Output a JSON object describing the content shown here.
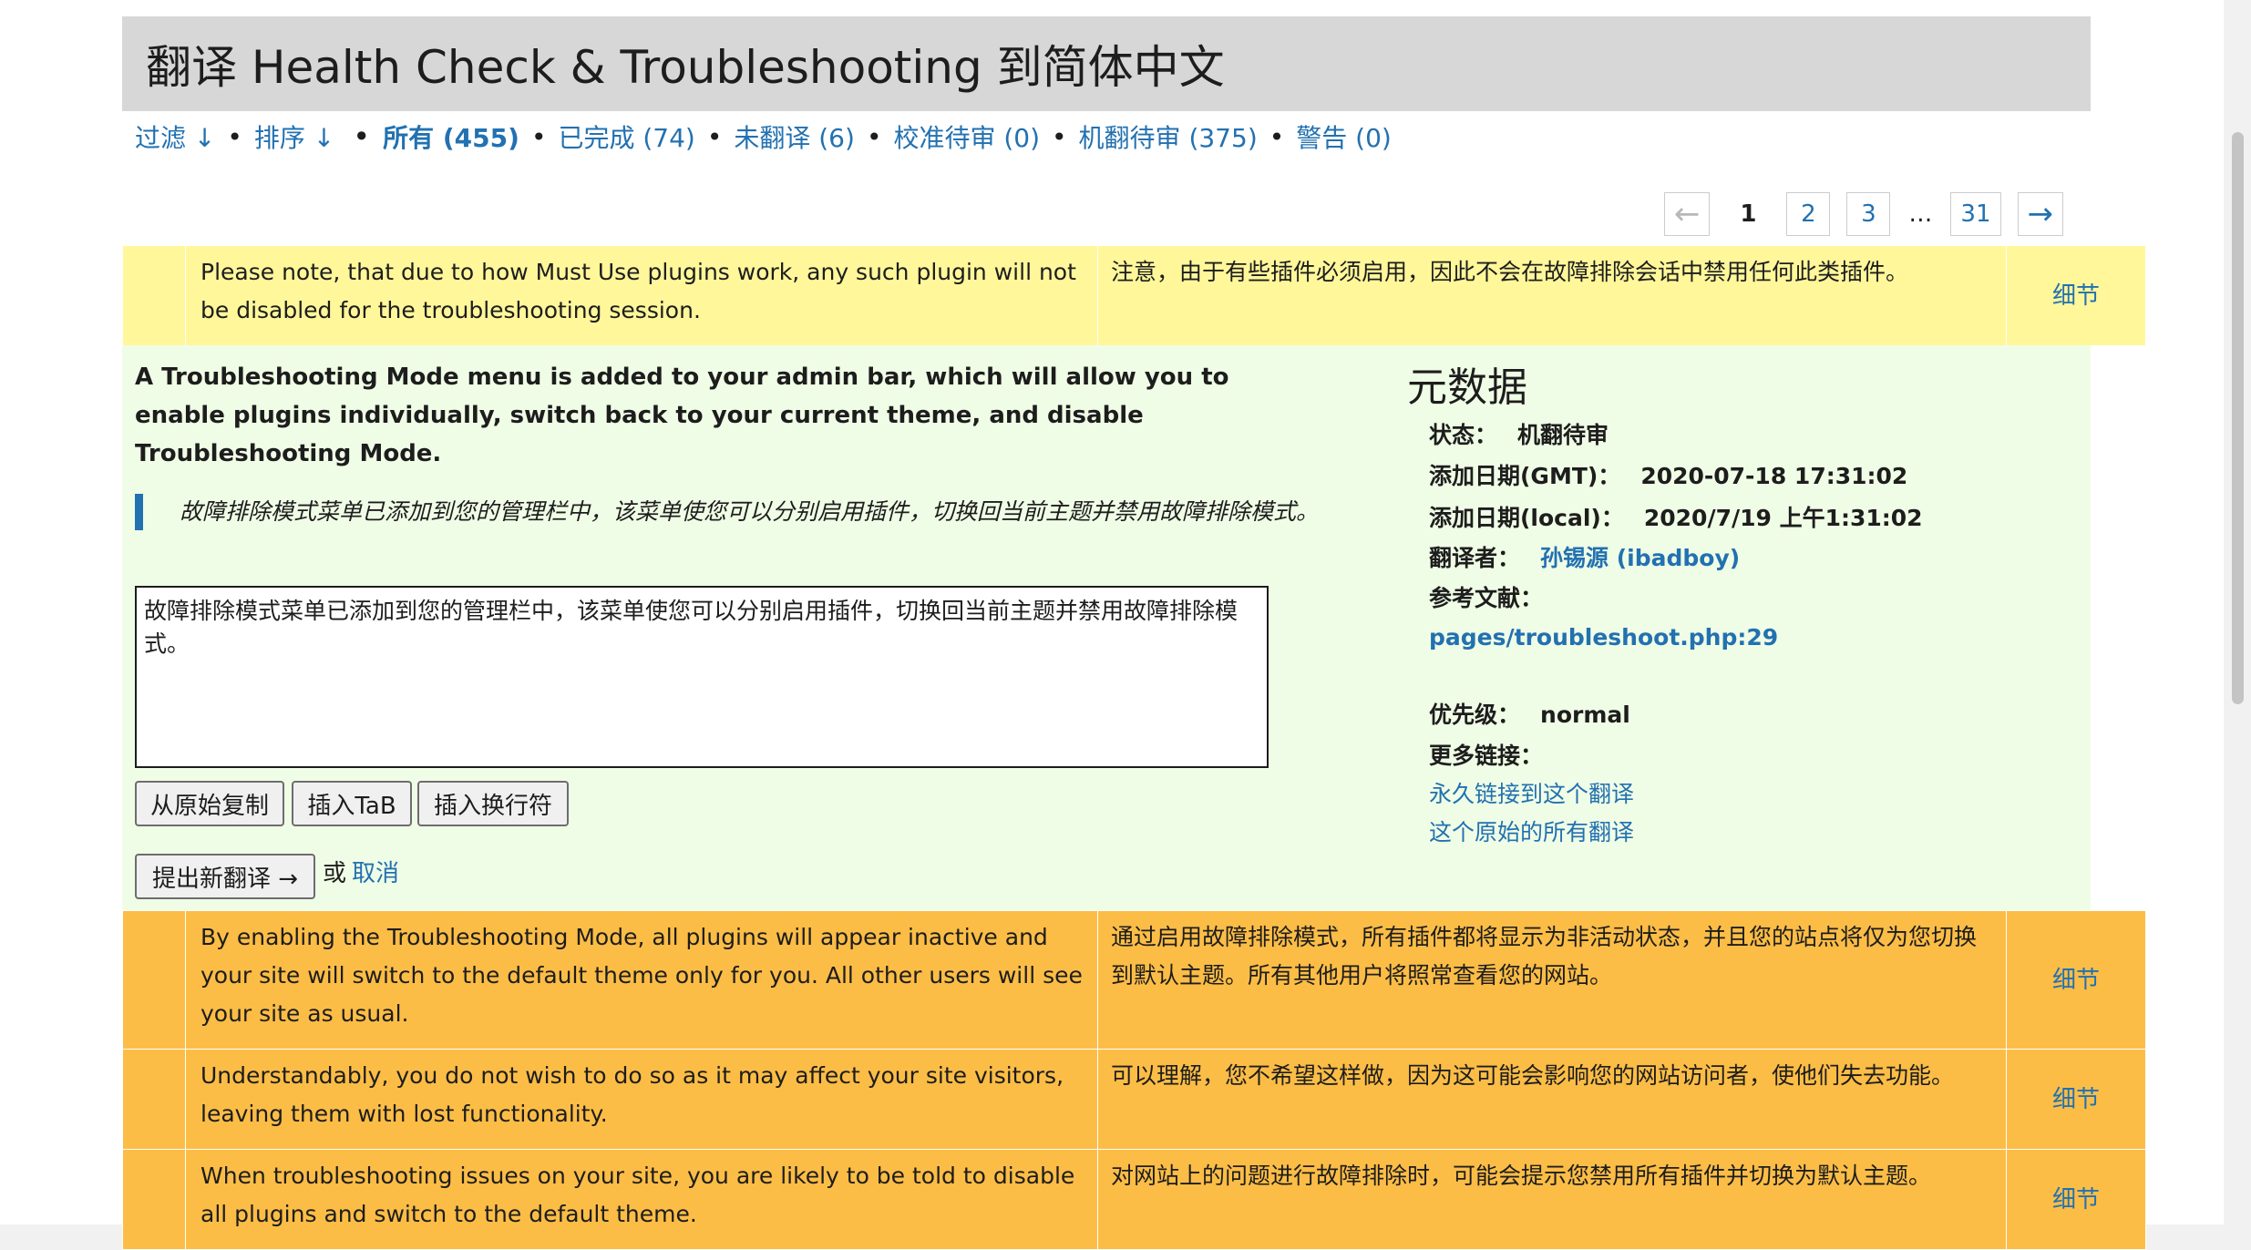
{
  "page_title": "翻译 Health Check & Troubleshooting 到简体中文",
  "filter_bar": {
    "filter_label": "过滤 ↓",
    "sort_label": "排序 ↓",
    "all_label": "所有 (455)",
    "done_label": "已完成 (74)",
    "untranslated_label": "未翻译 (6)",
    "waiting_label": "校准待审 (0)",
    "fuzzy_label": "机翻待审 (375)",
    "warnings_label": "警告 (0)"
  },
  "pager": {
    "prev": "←",
    "current": "1",
    "pages": [
      "2",
      "3"
    ],
    "ellipsis": "…",
    "last": "31",
    "next": "→"
  },
  "rows": [
    {
      "original": "Please note, that due to how Must Use plugins work, any such plugin will not be disabled for the troubleshooting session.",
      "translation": "注意，由于有些插件必须启用，因此不会在故障排除会话中禁用任何此类插件。",
      "action": "细节",
      "status_color": "#fff79a"
    },
    {
      "original": "By enabling the Troubleshooting Mode, all plugins will appear inactive and your site will switch to the default theme only for you. All other users will see your site as usual.",
      "translation": "通过启用故障排除模式，所有插件都将显示为非活动状态，并且您的站点将仅为您切换到默认主题。所有其他用户将照常查看您的网站。",
      "action": "细节",
      "status_color": "#fcbd46"
    },
    {
      "original": "Understandably, you do not wish to do so as it may affect your site visitors, leaving them with lost functionality.",
      "translation": "可以理解，您不希望这样做，因为这可能会影响您的网站访问者，使他们失去功能。",
      "action": "细节",
      "status_color": "#fcbd46"
    },
    {
      "original": "When troubleshooting issues on your site, you are likely to be told to disable all plugins and switch to the default theme.",
      "translation": "对网站上的问题进行故障排除时，可能会提示您禁用所有插件并切换为默认主题。",
      "action": "细节",
      "status_color": "#fcbd46"
    }
  ],
  "editor": {
    "original": "A Troubleshooting Mode menu is added to your admin bar, which will allow you to enable plugins individually, switch back to your current theme, and disable Troubleshooting Mode.",
    "current_translation": "故障排除模式菜单已添加到您的管理栏中，该菜单使您可以分别启用插件，切换回当前主题并禁用故障排除模式。",
    "textarea_value": "故障排除模式菜单已添加到您的管理栏中，该菜单使您可以分别启用插件，切换回当前主题并禁用故障排除模式。",
    "copy_button": "从原始复制",
    "insert_tab_button": "插入TaB",
    "insert_newline_button": "插入换行符",
    "submit_button": "提出新翻译 →",
    "or_text": "或",
    "cancel_link": "取消",
    "background": "#f0fde6"
  },
  "meta": {
    "heading": "元数据",
    "status_label": "状态：",
    "status_value": "机翻待审",
    "added_gmt_label": "添加日期(GMT)：",
    "added_gmt_value": "2020-07-18 17:31:02",
    "added_local_label": "添加日期(local)：",
    "added_local_value": "2020/7/19 上午1:31:02",
    "translator_label": "翻译者：",
    "translator_value": "孙锡源 (ibadboy)",
    "references_label": "参考文献：",
    "reference_value": "pages/troubleshoot.php:29",
    "priority_label": "优先级：",
    "priority_value": "normal",
    "more_links_label": "更多链接：",
    "permalink": "永久链接到这个翻译",
    "all_translations": "这个原始的所有翻译"
  },
  "colors": {
    "link": "#2271b1",
    "title_bg": "#d7d7d7",
    "current_row": "#fff79a",
    "fuzzy_row": "#fcbd46"
  }
}
